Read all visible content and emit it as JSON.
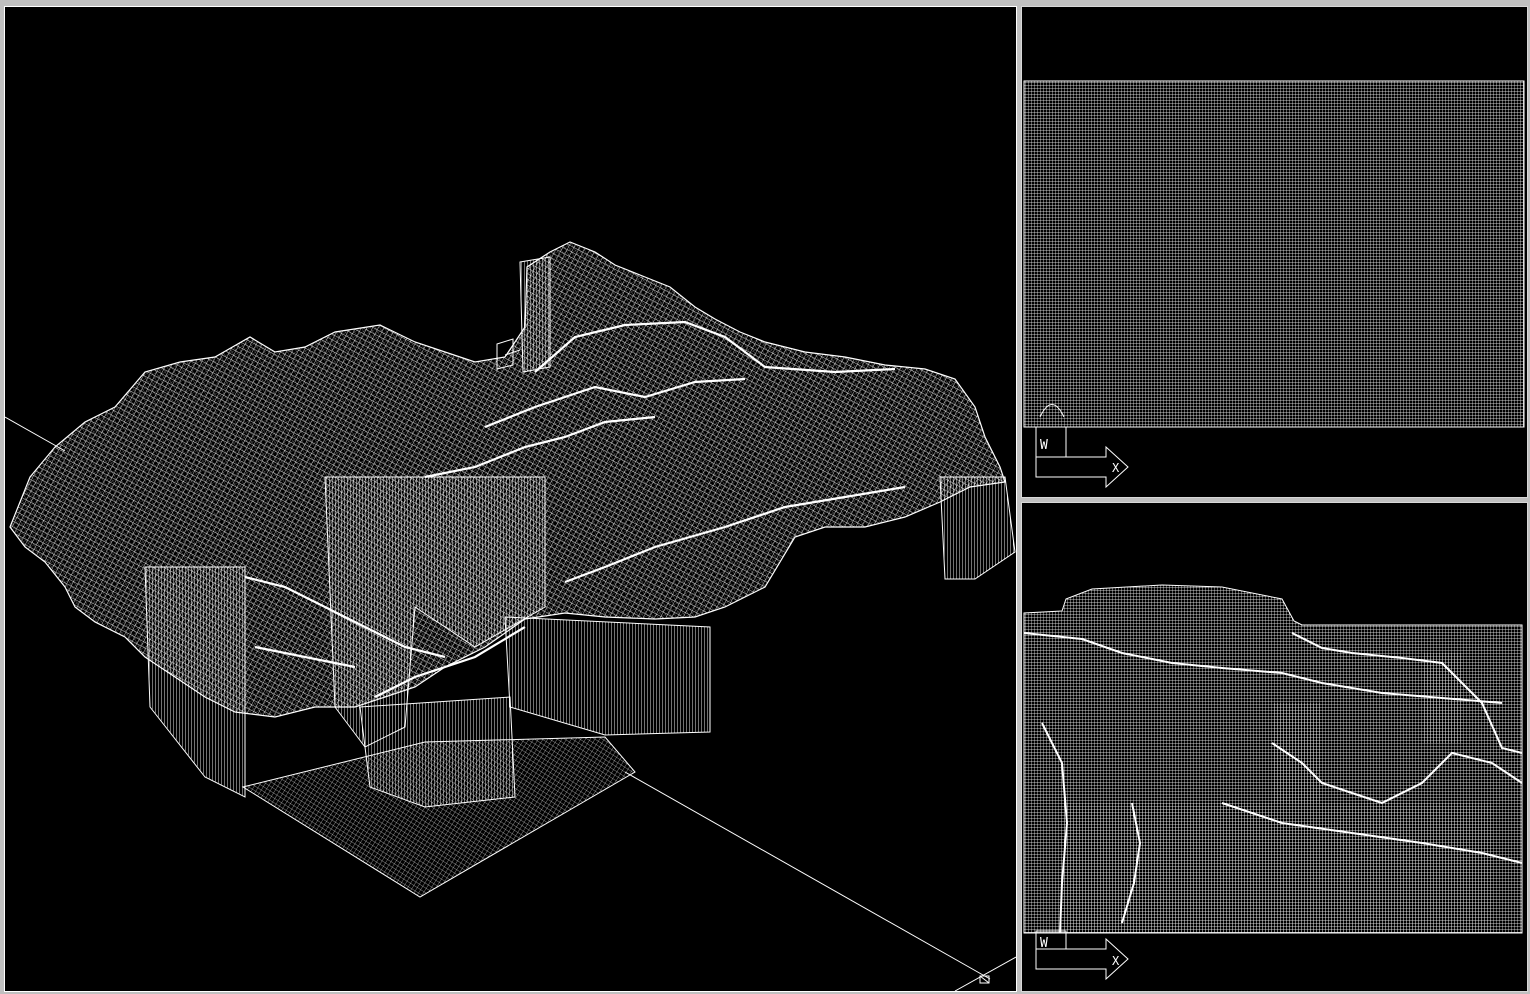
{
  "app": {
    "type": "cad-wireframe-viewports"
  },
  "viewports": [
    {
      "id": "main",
      "view": "3d-isometric",
      "active": true,
      "content": "wireframe-terrain-mesh",
      "ucs_icon": "ucs-broken-pencil-icon"
    },
    {
      "id": "top",
      "view": "plan",
      "active": false,
      "content": "wireframe-grid-mesh",
      "ucs_icon": "ucs-icon",
      "ucs_axes": {
        "x": "X",
        "y": "W"
      }
    },
    {
      "id": "front",
      "view": "elevation",
      "active": false,
      "content": "wireframe-terrain-elevation",
      "ucs_icon": "ucs-icon",
      "ucs_axes": {
        "x": "X",
        "y": "W"
      }
    }
  ],
  "colors": {
    "background": "#000000",
    "wire": "#ffffff",
    "border": "#ffffff"
  }
}
